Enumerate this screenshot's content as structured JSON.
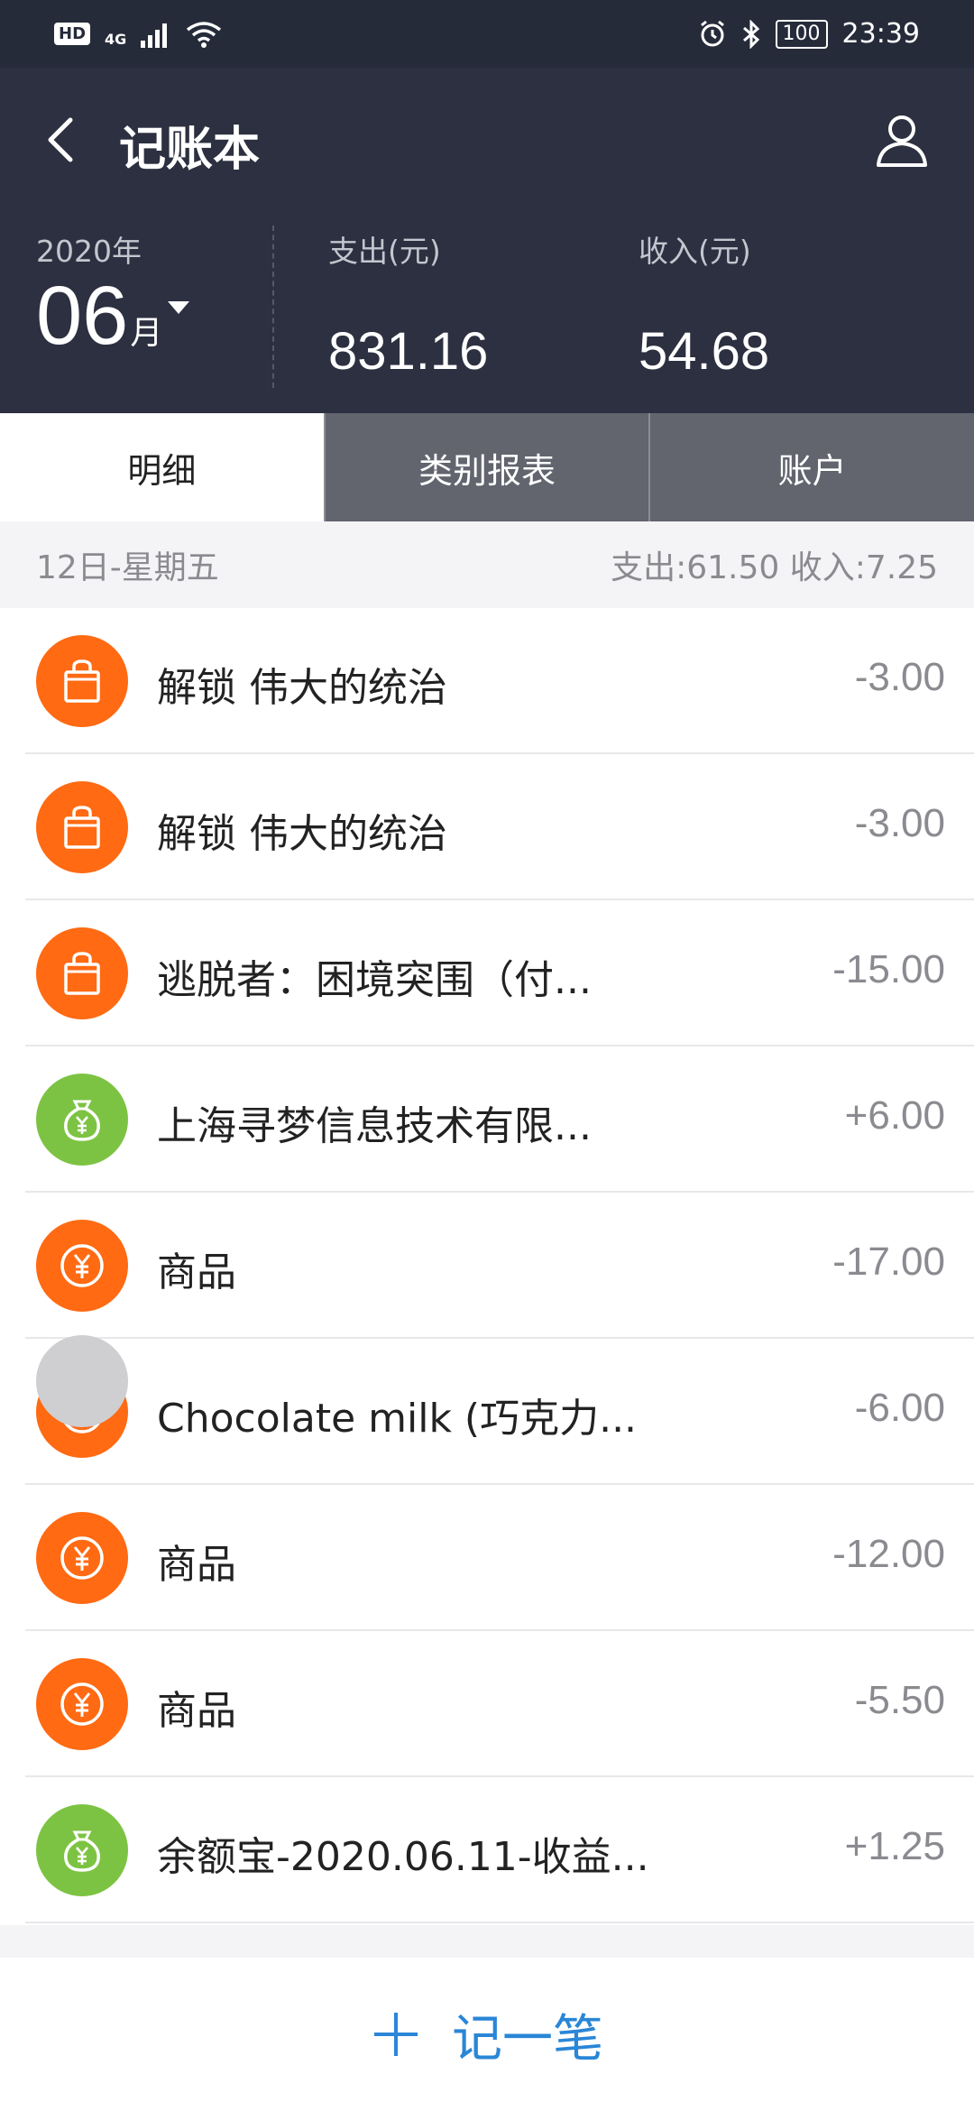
{
  "status_bar": {
    "hd": "HD",
    "network": "4G",
    "battery": "100",
    "time": "23:39"
  },
  "header": {
    "title": "记账本",
    "year": "2020年",
    "month": "06",
    "month_unit": "月",
    "expense_label": "支出(元)",
    "expense_value": "831.16",
    "income_label": "收入(元)",
    "income_value": "54.68"
  },
  "tabs": [
    {
      "label": "明细",
      "active": true
    },
    {
      "label": "类别报表",
      "active": false
    },
    {
      "label": "账户",
      "active": false
    }
  ],
  "day": {
    "date": "12日-星期五",
    "summary": "支出:61.50 收入:7.25"
  },
  "transactions": [
    {
      "title": "解锁 伟大的统治",
      "amount": "-3.00",
      "icon": "shopping-bag-icon",
      "color": "#ff6a13"
    },
    {
      "title": "解锁 伟大的统治",
      "amount": "-3.00",
      "icon": "shopping-bag-icon",
      "color": "#ff6a13"
    },
    {
      "title": "逃脱者：困境突围（付...",
      "amount": "-15.00",
      "icon": "shopping-bag-icon",
      "color": "#ff6a13"
    },
    {
      "title": "上海寻梦信息技术有限...",
      "amount": "+6.00",
      "icon": "money-bag-icon",
      "color": "#7dc343"
    },
    {
      "title": "商品",
      "amount": "-17.00",
      "icon": "yuan-coin-icon",
      "color": "#ff6a13"
    },
    {
      "title": "Chocolate milk (巧克力...",
      "amount": "-6.00",
      "icon": "yuan-coin-icon",
      "color": "#ff6a13"
    },
    {
      "title": "商品",
      "amount": "-12.00",
      "icon": "yuan-coin-icon",
      "color": "#ff6a13"
    },
    {
      "title": "商品",
      "amount": "-5.50",
      "icon": "yuan-coin-icon",
      "color": "#ff6a13"
    },
    {
      "title": "余额宝-2020.06.11-收益...",
      "amount": "+1.25",
      "icon": "money-bag-icon",
      "color": "#7dc343"
    }
  ],
  "bottom": {
    "add_label": "记一笔"
  },
  "colors": {
    "header_bg": "#2c3040",
    "expense_accent": "#ff6a13",
    "income_accent": "#7dc343",
    "action_blue": "#2a86d6"
  }
}
